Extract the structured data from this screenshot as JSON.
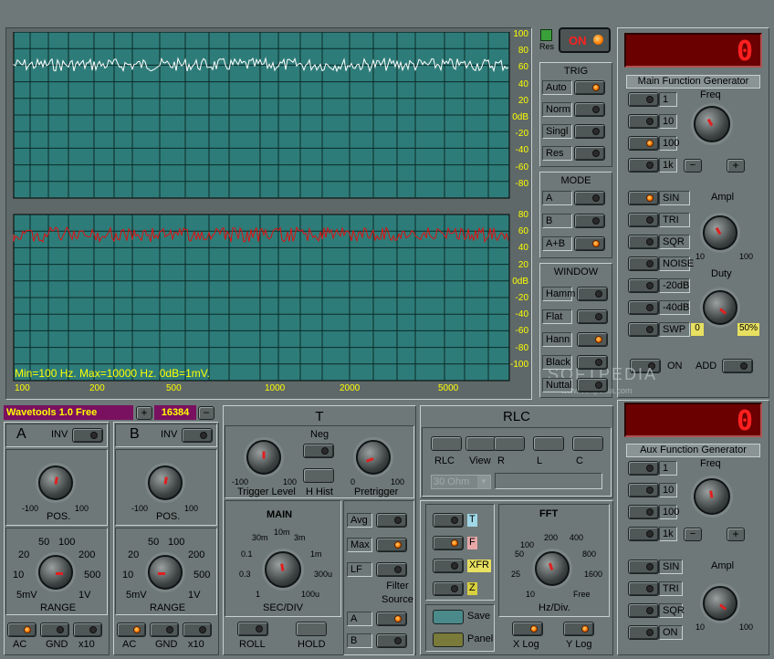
{
  "plot": {
    "ylabels_top": [
      "100",
      "80",
      "60",
      "40",
      "20",
      "0dB",
      "-20",
      "-40",
      "-60",
      "-80"
    ],
    "ylabels_bottom": [
      "80",
      "60",
      "40",
      "20",
      "0dB",
      "-20",
      "-40",
      "-60",
      "-80",
      "-100"
    ],
    "xlabels": [
      "100",
      "200",
      "500",
      "1000",
      "2000",
      "5000"
    ],
    "info": "Min=100 Hz.  Max=10000 Hz.  0dB=1mV.",
    "trace_top_color": "#ffffff",
    "trace_bottom_color": "#e01010"
  },
  "power": {
    "res_label": "Res",
    "on_label": "ON"
  },
  "trig": {
    "title": "TRIG",
    "items": [
      "Auto",
      "Norm",
      "Singl",
      "Res"
    ]
  },
  "mode": {
    "title": "MODE",
    "items": [
      "A",
      "B",
      "A+B"
    ]
  },
  "window": {
    "title": "WINDOW",
    "items": [
      "Hamm",
      "Flat",
      "Hann",
      "Black",
      "Nuttal"
    ]
  },
  "main_gen": {
    "display": "0",
    "title": "Main Function Generator",
    "freq_label": "Freq",
    "ranges": [
      "1",
      "10",
      "100",
      "1k"
    ],
    "minus": "−",
    "plus": "+",
    "waves": [
      "SIN",
      "TRI",
      "SQR",
      "NOISE",
      "-20dB",
      "-40dB",
      "SWP"
    ],
    "ampl_label": "Ampl",
    "ampl_min": "10",
    "ampl_max": "100",
    "duty_label": "Duty",
    "duty_min": "0",
    "duty_max": "50%",
    "on_label": "ON",
    "add_label": "ADD"
  },
  "aux_gen": {
    "display": "0",
    "title": "Aux Function Generator",
    "freq_label": "Freq",
    "ranges": [
      "1",
      "10",
      "100",
      "1k"
    ],
    "minus": "−",
    "plus": "+",
    "waves": [
      "SIN",
      "TRI",
      "SQR",
      "ON"
    ],
    "ampl_label": "Ampl",
    "ampl_min": "10",
    "ampl_max": "100"
  },
  "status": {
    "app_name": "Wavetools 1.0 Free",
    "plus": "+",
    "minus": "−",
    "samples": "16384"
  },
  "watermark": {
    "text": "SOFTPEDIA",
    "sub": "www.softpedia.com"
  },
  "chan_a": {
    "name": "A",
    "inv": "INV",
    "pos": "POS.",
    "pos_min": "-100",
    "pos_max": "100",
    "range": "RANGE",
    "range_ticks": [
      "50",
      "100",
      "20",
      "200",
      "10",
      "500",
      "5mV",
      "1V"
    ],
    "buttons": [
      "AC",
      "GND",
      "x10"
    ]
  },
  "chan_b": {
    "name": "B",
    "inv": "INV",
    "pos": "POS.",
    "pos_min": "-100",
    "pos_max": "100",
    "range": "RANGE",
    "range_ticks": [
      "50",
      "100",
      "20",
      "200",
      "10",
      "500",
      "5mV",
      "1V"
    ],
    "buttons": [
      "AC",
      "GND",
      "x10"
    ]
  },
  "timebase": {
    "title": "T",
    "neg": "Neg",
    "trig_level": "Trigger Level",
    "tl_min": "-100",
    "tl_max": "100",
    "hhist": "H Hist",
    "pretrigger": "Pretrigger",
    "pt_min": "0",
    "pt_max": "100",
    "main": "MAIN",
    "secdiv": "SEC/DIV",
    "sec_ticks": [
      "30m",
      "10m",
      "3m",
      "0.1",
      "1m",
      "0.3",
      "300u",
      "1",
      "100u"
    ],
    "opts": [
      "Avg",
      "Max",
      "LF"
    ],
    "filter_source": "Filter\nSource",
    "src": [
      "A",
      "B"
    ],
    "roll": "ROLL",
    "hold": "HOLD"
  },
  "rlc": {
    "title": "RLC",
    "labels": [
      "RLC",
      "View",
      "R",
      "L",
      "C"
    ],
    "ohm_value": "30 Ohm"
  },
  "fft": {
    "channels": [
      "T",
      "F",
      "XFR",
      "Z"
    ],
    "channel_colors": [
      "#a0d8e8",
      "#e8a8a8",
      "#e8e060",
      "#d8d040"
    ],
    "title": "FFT",
    "hz_div": "Hz/Div.",
    "ticks": [
      "200",
      "400",
      "100",
      "800",
      "50",
      "25",
      "1600",
      "10",
      "Free"
    ],
    "save": "Save",
    "panel": "Panel",
    "xlog": "X Log",
    "ylog": "Y Log"
  }
}
